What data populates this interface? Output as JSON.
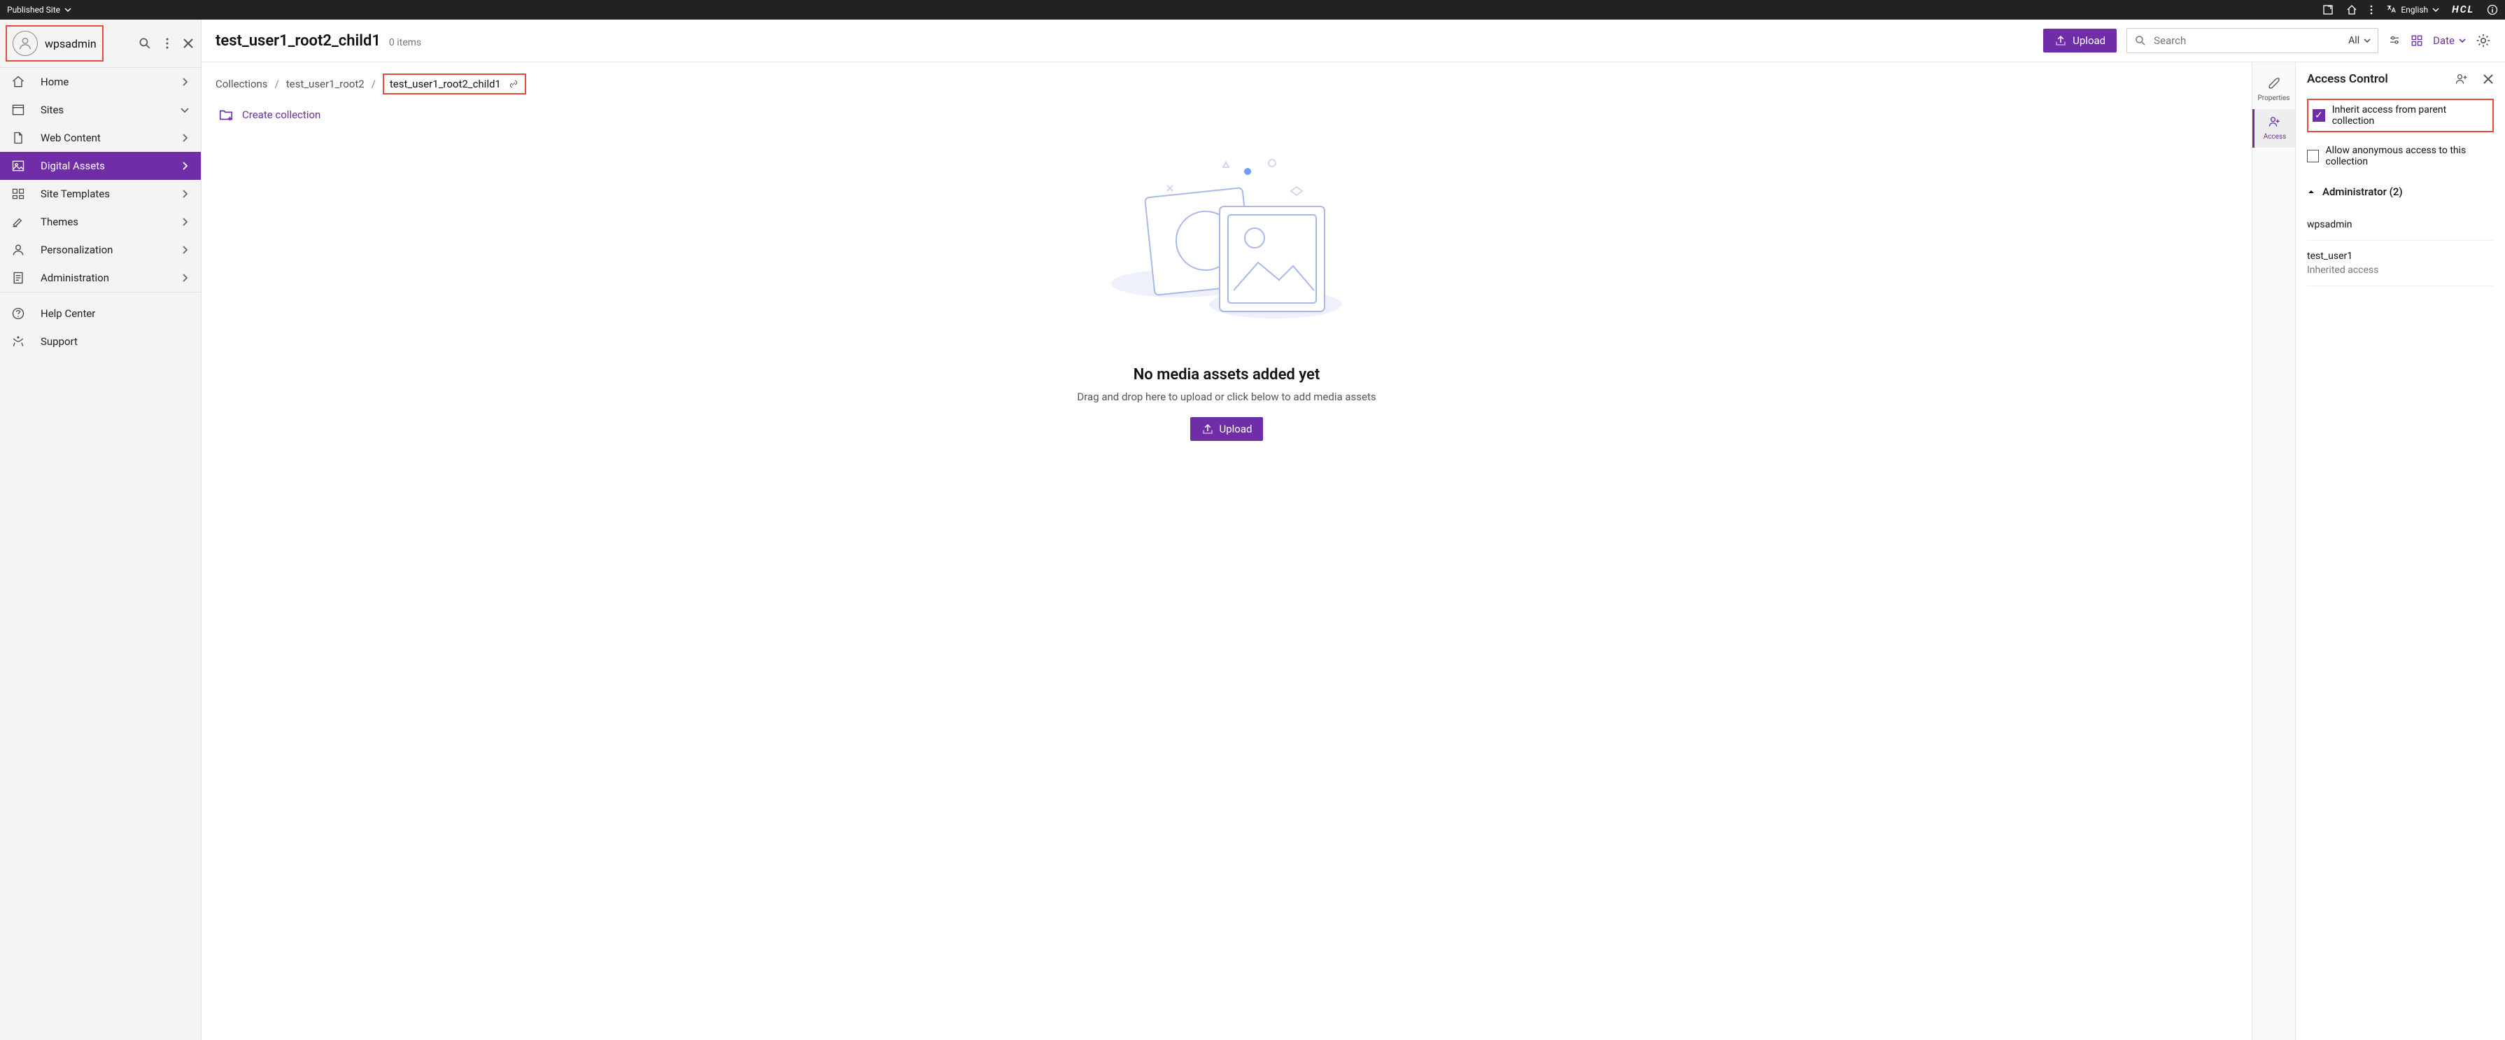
{
  "topbar": {
    "site_label": "Published Site",
    "language": "English",
    "brand": "HCL"
  },
  "sidebar": {
    "user": "wpsadmin",
    "items": [
      {
        "label": "Home",
        "chev": "right"
      },
      {
        "label": "Sites",
        "chev": "down"
      },
      {
        "label": "Web Content",
        "chev": "right"
      },
      {
        "label": "Digital Assets",
        "chev": "right",
        "active": true
      },
      {
        "label": "Site Templates",
        "chev": "right"
      },
      {
        "label": "Themes",
        "chev": "right"
      },
      {
        "label": "Personalization",
        "chev": "right"
      },
      {
        "label": "Administration",
        "chev": "right"
      }
    ],
    "footer": [
      {
        "label": "Help Center"
      },
      {
        "label": "Support"
      }
    ]
  },
  "header": {
    "title": "test_user1_root2_child1",
    "count_label": "0 items",
    "upload_label": "Upload",
    "search_placeholder": "Search",
    "search_filter": "All",
    "sort_label": "Date"
  },
  "breadcrumb": {
    "root": "Collections",
    "parent": "test_user1_root2",
    "current": "test_user1_root2_child1"
  },
  "actions": {
    "create_collection": "Create collection"
  },
  "empty": {
    "title": "No media assets added yet",
    "subtitle": "Drag and drop here to upload or click below to add media assets",
    "button": "Upload"
  },
  "rail": {
    "properties": "Properties",
    "access": "Access"
  },
  "access_panel": {
    "title": "Access Control",
    "inherit_label": "Inherit access from parent collection",
    "anonymous_label": "Allow anonymous access to this collection",
    "role_header": "Administrator (2)",
    "users": [
      {
        "name": "wpsadmin"
      },
      {
        "name": "test_user1",
        "sub": "Inherited access"
      }
    ]
  }
}
